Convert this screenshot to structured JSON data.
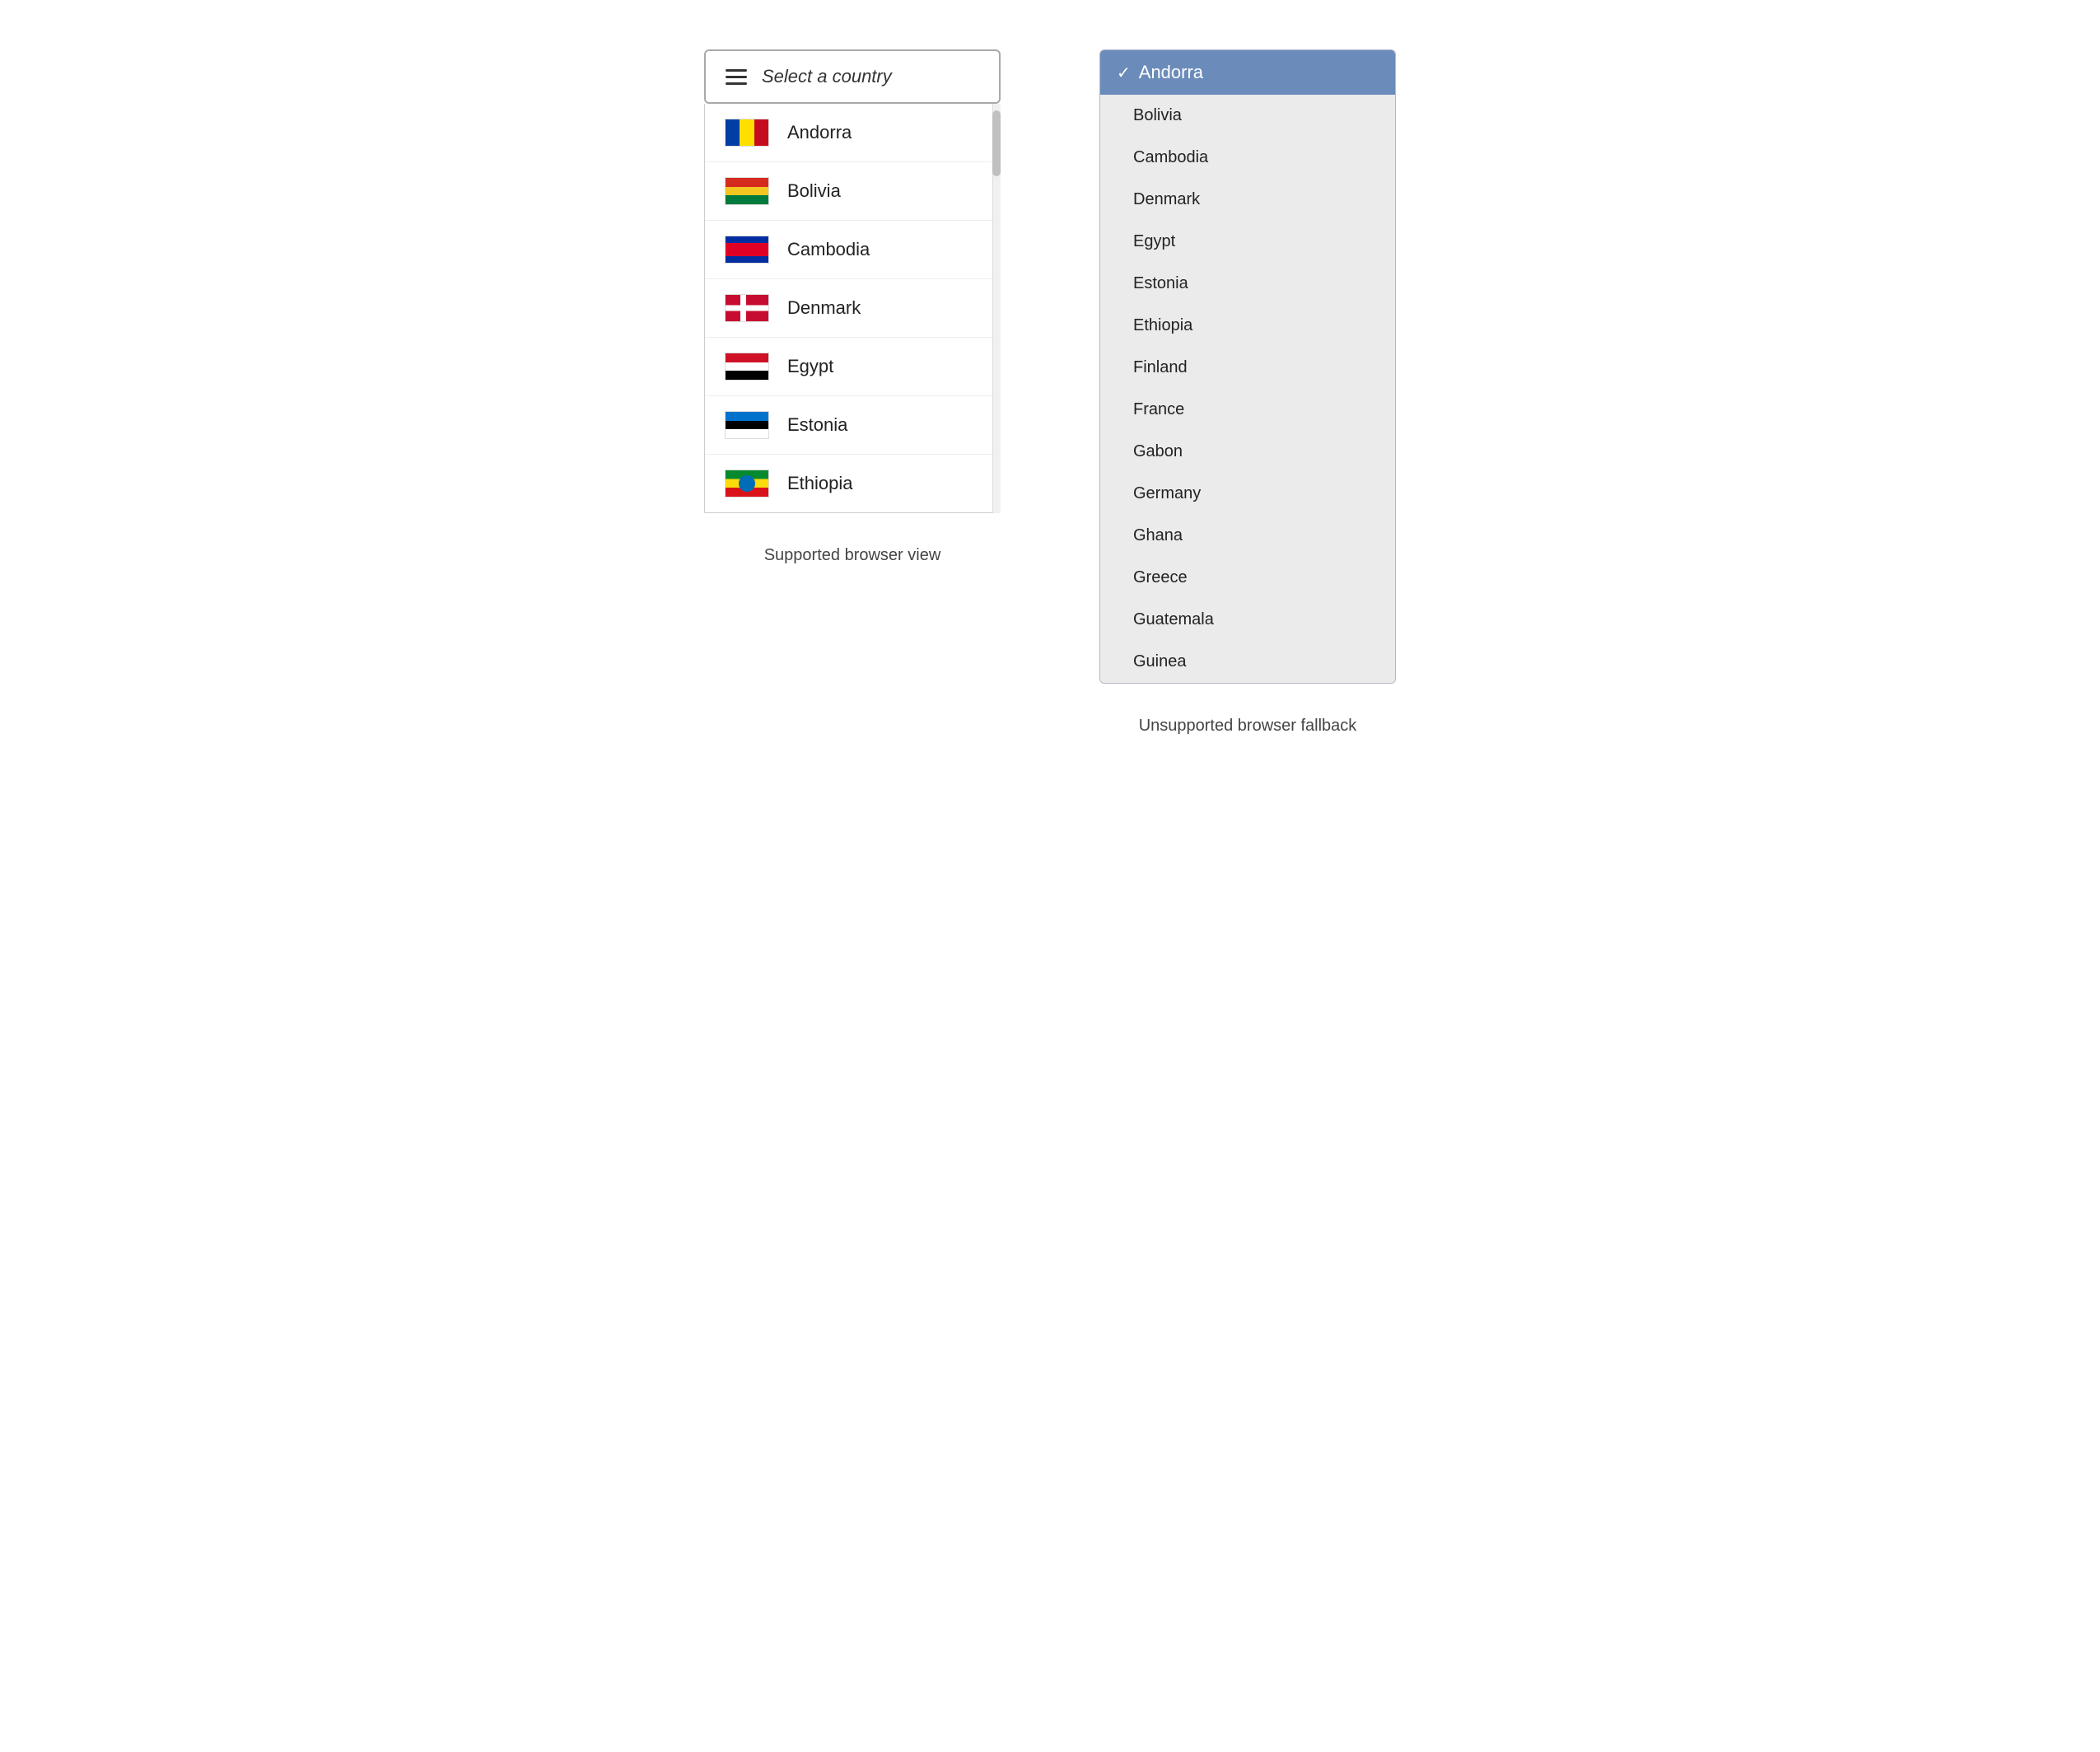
{
  "left": {
    "trigger_label": "Select a country",
    "panel_label": "Supported browser view",
    "countries": [
      {
        "id": "ad",
        "name": "Andorra"
      },
      {
        "id": "bo",
        "name": "Bolivia"
      },
      {
        "id": "kh",
        "name": "Cambodia"
      },
      {
        "id": "dk",
        "name": "Denmark"
      },
      {
        "id": "eg",
        "name": "Egypt"
      },
      {
        "id": "ee",
        "name": "Estonia"
      },
      {
        "id": "et",
        "name": "Ethiopia"
      }
    ]
  },
  "right": {
    "panel_label": "Unsupported browser fallback",
    "selected": "Andorra",
    "options": [
      "Andorra",
      "Bolivia",
      "Cambodia",
      "Denmark",
      "Egypt",
      "Estonia",
      "Ethiopia",
      "Finland",
      "France",
      "Gabon",
      "Germany",
      "Ghana",
      "Greece",
      "Guatemala",
      "Guinea"
    ]
  }
}
